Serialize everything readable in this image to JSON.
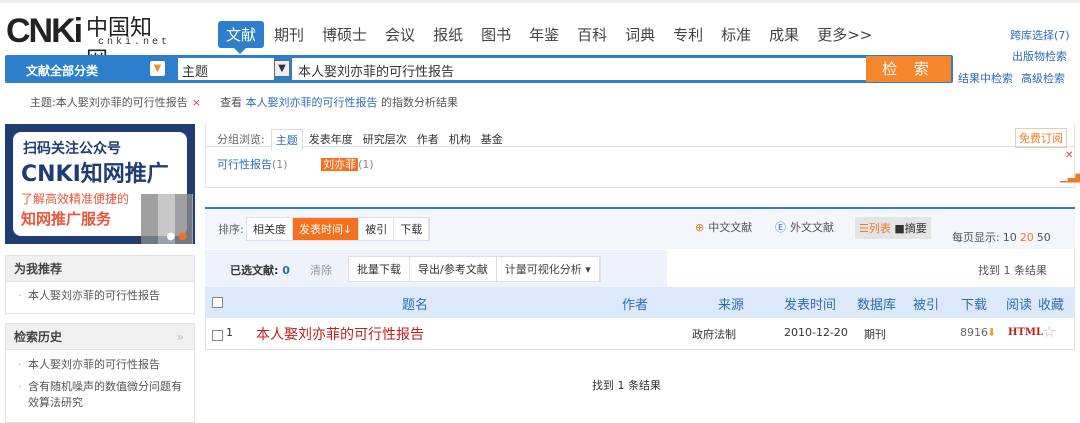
{
  "logo": {
    "brand": "CNKi",
    "cn": "中国知网",
    "domain": "cnki.net"
  },
  "nav": [
    "文献",
    "期刊",
    "博硕士",
    "会议",
    "报纸",
    "图书",
    "年鉴",
    "百科",
    "词典",
    "专利",
    "标准",
    "成果",
    "更多>>"
  ],
  "search": {
    "category": "文献全部分类",
    "field": "主题",
    "query": "本人娶刘亦菲的可行性报告",
    "button": "检 索"
  },
  "right_links": {
    "cross": "跨库选择(7)",
    "pub": "出版物检索",
    "within": "结果中检索",
    "advanced": "高级检索"
  },
  "tag": {
    "label": "主题:本人娶刘亦菲的可行性报告",
    "close": "×",
    "view": "查看",
    "link": "本人娶刘亦菲的可行性报告",
    "suffix": "的指数分析结果"
  },
  "banner": {
    "line1": "扫码关注公众号",
    "line2": "CNKI知网推广",
    "line3": "了解高效精准便捷的",
    "line4": "知网推广服务"
  },
  "recommend": {
    "title": "为我推荐",
    "items": [
      "本人娶刘亦菲的可行性报告"
    ]
  },
  "history": {
    "title": "检索历史",
    "items": [
      "本人娶刘亦菲的可行性报告",
      "含有随机噪声的数值微分问题有效算法研究"
    ]
  },
  "group": {
    "label": "分组浏览:",
    "tabs": [
      "主题",
      "发表年度",
      "研究层次",
      "作者",
      "机构",
      "基金"
    ],
    "subscribe": "免费订阅",
    "items": [
      {
        "name": "可行性报告",
        "count": "(1)"
      },
      {
        "name": "刘亦菲",
        "count": "(1)"
      }
    ]
  },
  "sort": {
    "label": "排序:",
    "options": [
      "相关度",
      "发表时间↓",
      "被引",
      "下载"
    ],
    "zh": "中文文献",
    "en": "外文文献",
    "list": "☰列表",
    "abstract": "■摘要",
    "perpage_label": "每页显示:",
    "perpage": [
      "10",
      "20",
      "50"
    ]
  },
  "selection": {
    "label": "已选文献:",
    "count": "0",
    "clear": "清除",
    "actions": [
      "批量下载",
      "导出/参考文献",
      "计量可视化分析 ▾"
    ],
    "found": "找到 1 条结果"
  },
  "table": {
    "headers": [
      "题名",
      "作者",
      "来源",
      "发表时间",
      "数据库",
      "被引",
      "下载",
      "阅读",
      "收藏"
    ],
    "rows": [
      {
        "index": "1",
        "title": "本人娶刘亦菲的可行性报告",
        "author": "",
        "source": "政府法制",
        "date": "2010-12-20",
        "db": "期刊",
        "cited": "",
        "downloads": "8916",
        "read": "HTML"
      }
    ]
  },
  "footer": {
    "found": "找到 1 条结果"
  }
}
